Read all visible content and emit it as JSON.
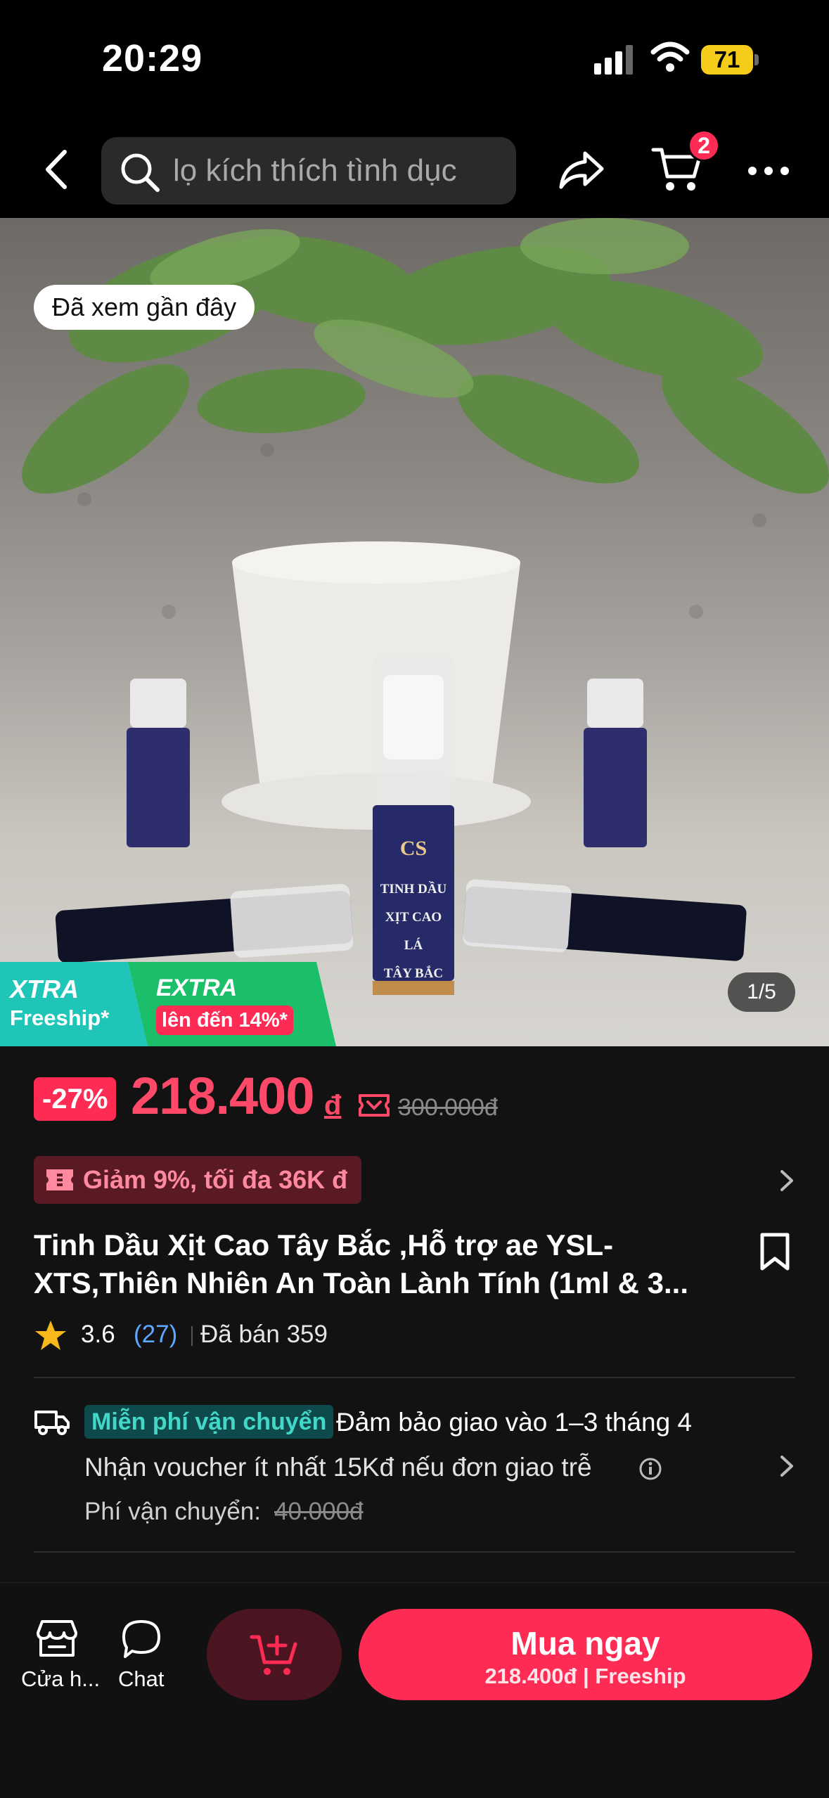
{
  "status_bar": {
    "time": "20:29",
    "battery": "71"
  },
  "nav": {
    "search_text": "lọ kích thích tình dục",
    "cart_count": "2"
  },
  "hero": {
    "recently_viewed": "Đã xem gần đây",
    "promo_xtra": "XTRA",
    "promo_freeship": "Freeship*",
    "promo_extra": "EXTRA",
    "promo_extra_value": "lên đến 14%*",
    "image_counter": "1/5",
    "bottle_brand": "CS",
    "bottle_text": [
      "TINH DẦU",
      "XỊT CAO LÁ",
      "TÂY BẮC"
    ]
  },
  "price": {
    "discount": "-27%",
    "current": "218.400",
    "currency": "đ",
    "original": "300.000đ"
  },
  "coupon": {
    "label": "Giảm 9%, tối đa 36K đ"
  },
  "product": {
    "title": "Tinh Dầu Xịt Cao Tây Bắc ,Hỗ trợ ae YSL-XTS,Thiên Nhiên An Toàn Lành Tính (1ml & 3...",
    "rating": "3.6",
    "review_count": "(27)",
    "sold": "Đã bán 359"
  },
  "shipping": {
    "free_badge": "Miễn phí vận chuyển",
    "guarantee": "Đảm bảo giao vào 1–3 tháng 4",
    "voucher": "Nhận voucher ít nhất 15Kđ nếu đơn giao trễ",
    "fee_label": "Phí vận chuyển:",
    "fee_value": "40.000đ"
  },
  "bottom_bar": {
    "shop_label": "Cửa h...",
    "chat_label": "Chat",
    "buy_label": "Mua ngay",
    "buy_sub": "218.400đ | Freeship"
  },
  "colors": {
    "accent": "#fe2c55",
    "background": "#121212",
    "teal": "#43d7c8",
    "promo_green": "#1bbf6a"
  }
}
